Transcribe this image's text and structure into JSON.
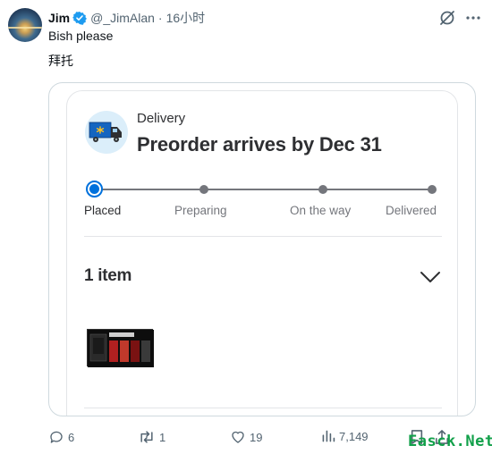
{
  "tweet": {
    "author_name": "Jim",
    "handle": "@_JimAlan",
    "separator": "·",
    "time": "16小时",
    "text_line1": "Bish please",
    "text_line2": "拜托"
  },
  "order_card": {
    "delivery_label": "Delivery",
    "title": "Preorder arrives by Dec 31",
    "steps": [
      "Placed",
      "Preparing",
      "On the way",
      "Delivered"
    ],
    "active_step": "Placed",
    "items_title": "1 item",
    "accent_color": "#0071dc"
  },
  "actions": {
    "replies": "6",
    "reposts": "1",
    "likes": "19",
    "views": "7,149"
  },
  "watermark": "Easck.Net",
  "colors": {
    "verified": "#1d9bf0",
    "muted": "#536471",
    "watermark": "#12a04a"
  }
}
